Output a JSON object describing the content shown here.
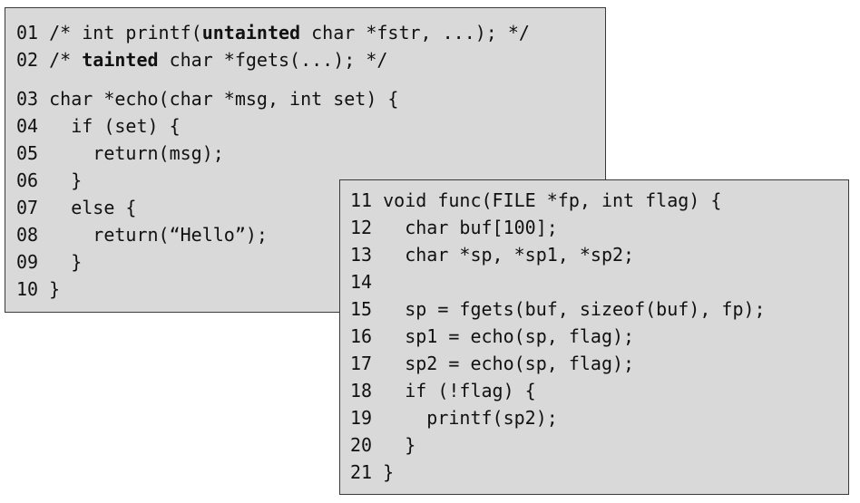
{
  "left_panel": {
    "lines": [
      {
        "num": "01",
        "segments": [
          {
            "text": "/* int printf(",
            "bold": false
          },
          {
            "text": "untainted",
            "bold": true
          },
          {
            "text": " char *fstr, ...); */",
            "bold": false
          }
        ]
      },
      {
        "num": "02",
        "segments": [
          {
            "text": "/* ",
            "bold": false
          },
          {
            "text": "tainted",
            "bold": true
          },
          {
            "text": " char *fgets(...); */",
            "bold": false
          }
        ]
      },
      {
        "num": "03",
        "segments": [
          {
            "text": "char *echo(char *msg, int set) {",
            "bold": false
          }
        ]
      },
      {
        "num": "04",
        "segments": [
          {
            "text": "  if (set) {",
            "bold": false
          }
        ]
      },
      {
        "num": "05",
        "segments": [
          {
            "text": "    return(msg);",
            "bold": false
          }
        ]
      },
      {
        "num": "06",
        "segments": [
          {
            "text": "  }",
            "bold": false
          }
        ]
      },
      {
        "num": "07",
        "segments": [
          {
            "text": "  else {",
            "bold": false
          }
        ]
      },
      {
        "num": "08",
        "segments": [
          {
            "text": "    return(“Hello”);",
            "bold": false
          }
        ]
      },
      {
        "num": "09",
        "segments": [
          {
            "text": "  }",
            "bold": false
          }
        ]
      },
      {
        "num": "10",
        "segments": [
          {
            "text": "}",
            "bold": false
          }
        ]
      }
    ]
  },
  "right_panel": {
    "lines": [
      {
        "num": "11",
        "segments": [
          {
            "text": "void func(FILE *fp, int flag) {",
            "bold": false
          }
        ]
      },
      {
        "num": "12",
        "segments": [
          {
            "text": "  char buf[100];",
            "bold": false
          }
        ]
      },
      {
        "num": "13",
        "segments": [
          {
            "text": "  char *sp, *sp1, *sp2;",
            "bold": false
          }
        ]
      },
      {
        "num": "14",
        "segments": [
          {
            "text": "",
            "bold": false
          }
        ]
      },
      {
        "num": "15",
        "segments": [
          {
            "text": "  sp = fgets(buf, sizeof(buf), fp);",
            "bold": false
          }
        ]
      },
      {
        "num": "16",
        "segments": [
          {
            "text": "  sp1 = echo(sp, flag);",
            "bold": false
          }
        ]
      },
      {
        "num": "17",
        "segments": [
          {
            "text": "  sp2 = echo(sp, flag);",
            "bold": false
          }
        ]
      },
      {
        "num": "18",
        "segments": [
          {
            "text": "  if (!flag) {",
            "bold": false
          }
        ]
      },
      {
        "num": "19",
        "segments": [
          {
            "text": "    printf(sp2);",
            "bold": false
          }
        ]
      },
      {
        "num": "20",
        "segments": [
          {
            "text": "  }",
            "bold": false
          }
        ]
      },
      {
        "num": "21",
        "segments": [
          {
            "text": "}",
            "bold": false
          }
        ]
      }
    ]
  },
  "colors": {
    "panel_background": "#d9d9d9",
    "panel_border": "#3a3a3a",
    "text": "#111111"
  }
}
